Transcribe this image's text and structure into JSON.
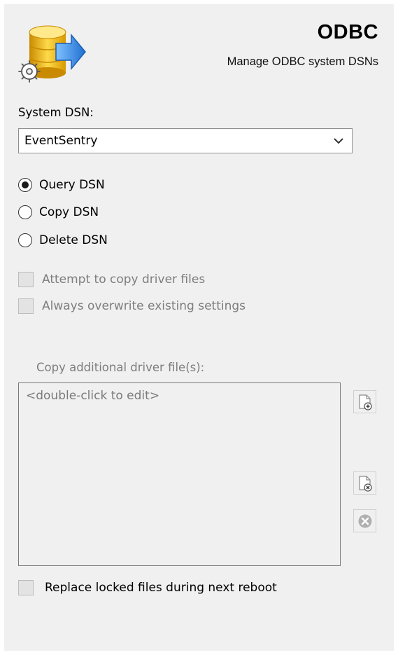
{
  "header": {
    "title": "ODBC",
    "subtitle": "Manage ODBC system DSNs",
    "icon": "database-gear-arrow-icon"
  },
  "dsn": {
    "label": "System DSN:",
    "selected": "EventSentry"
  },
  "actions": [
    {
      "label": "Query DSN",
      "checked": true
    },
    {
      "label": "Copy DSN",
      "checked": false
    },
    {
      "label": "Delete DSN",
      "checked": false
    }
  ],
  "options": {
    "copy_driver_files": "Attempt to copy driver files",
    "overwrite_settings": "Always overwrite existing settings"
  },
  "driver_files": {
    "label": "Copy additional driver file(s):",
    "placeholder": "<double-click to edit>"
  },
  "replace_locked": "Replace locked files during next reboot",
  "colors": {
    "panel_bg": "#f0f0f0",
    "db_gold": "#f2c200",
    "arrow_blue": "#3a8ee6",
    "disabled_text": "#7d7d7d"
  }
}
